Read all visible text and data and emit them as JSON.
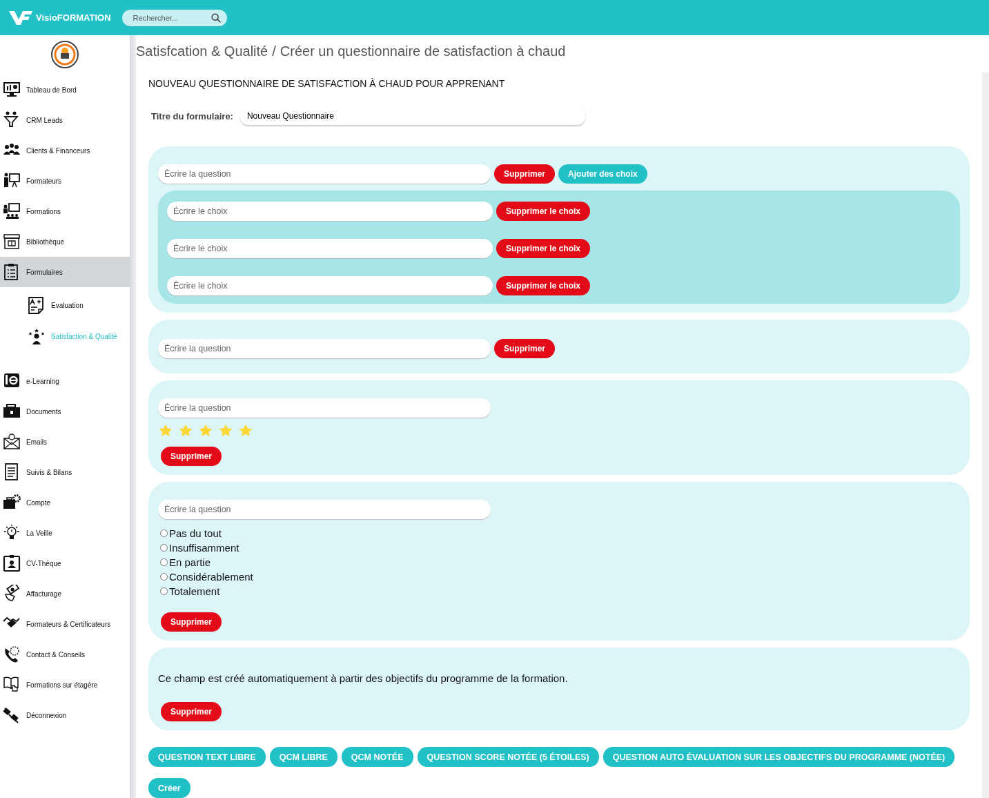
{
  "header": {
    "brand": "VisioFORMATION",
    "search": {
      "placeholder": "Rechercher..."
    }
  },
  "sidebar": {
    "items": [
      {
        "label": "Tableau de Bord",
        "selected": false
      },
      {
        "label": "CRM Leads",
        "selected": false
      },
      {
        "label": "Clients & Financeurs",
        "selected": false
      },
      {
        "label": "Formateurs",
        "selected": false
      },
      {
        "label": "Formations",
        "selected": false
      },
      {
        "label": "Bibliothèque",
        "selected": false
      },
      {
        "label": "Formulaires",
        "selected": true,
        "children": [
          {
            "label": "Evaluation",
            "selected": false
          },
          {
            "label": "Satisfaction & Qualité",
            "selected": true
          }
        ]
      },
      {
        "label": "e-Learning",
        "selected": false
      },
      {
        "label": "Documents",
        "selected": false
      },
      {
        "label": "Emails",
        "selected": false
      },
      {
        "label": "Suivis & Bilans",
        "selected": false
      },
      {
        "label": "Compte",
        "selected": false
      },
      {
        "label": "La Veille",
        "selected": false
      },
      {
        "label": "CV-Thèque",
        "selected": false
      },
      {
        "label": "Affacturage",
        "selected": false
      },
      {
        "label": "Formateurs & Certificateurs",
        "selected": false
      },
      {
        "label": "Contact & Conseils",
        "selected": false
      },
      {
        "label": "Formations sur étagère",
        "selected": false
      },
      {
        "label": "Déconnexion",
        "selected": false
      }
    ]
  },
  "breadcrumb": [
    "Satisfcation & Qualité",
    "/",
    "Créer un questionnaire de satisfaction à chaud"
  ],
  "form": {
    "heading": "NOUVEAU QUESTIONNAIRE DE SATISFACTION À CHAUD POUR APPRENANT",
    "title_field": {
      "label": "Titre du formulaire:",
      "value": "Nouveau Questionnaire"
    },
    "questions": [
      {
        "kind": "choices",
        "placeholder": "Écrire la question",
        "delete": "Supprimer",
        "add_choices": "Ajouter des choix",
        "choices": [
          {
            "placeholder": "Écrire le choix",
            "delete": "Supprimer le choix"
          },
          {
            "placeholder": "Écrire le choix",
            "delete": "Supprimer le choix"
          },
          {
            "placeholder": "Écrire le choix",
            "delete": "Supprimer le choix"
          }
        ]
      },
      {
        "kind": "text",
        "placeholder": "Écrire la question",
        "delete": "Supprimer"
      },
      {
        "kind": "stars",
        "placeholder": "Écrire la question",
        "stars": 5,
        "delete": "Supprimer"
      },
      {
        "kind": "radio",
        "placeholder": "Écrire la question",
        "options": [
          {
            "label": "Pas du tout",
            "selected": false
          },
          {
            "label": "Insuffisamment",
            "selected": false
          },
          {
            "label": "En partie",
            "selected": false
          },
          {
            "label": "Considérablement",
            "selected": false
          },
          {
            "label": "Totalement",
            "selected": false
          }
        ],
        "delete": "Supprimer"
      },
      {
        "kind": "auto",
        "text": "Ce champ est créé automatiquement à partir des objectifs du programme de la formation.",
        "delete": "Supprimer"
      }
    ],
    "add_buttons": [
      "QUESTION TEXT LIBRE",
      "QCM LIBRE",
      "QCM NOTÉE",
      "QUESTION SCORE NOTÉE (5 ÉTOILES)",
      "QUESTION AUTO ÉVALUATION SUR LES OBJECTIFS DU PROGRAMME (NOTÉE)"
    ],
    "create": "Créer"
  }
}
